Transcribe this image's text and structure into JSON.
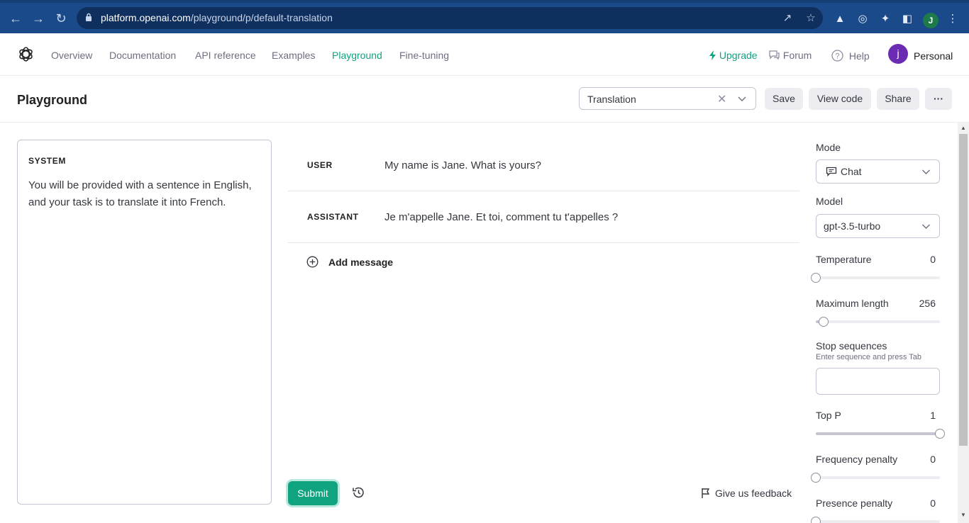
{
  "browser": {
    "url_host": "platform.openai.com",
    "url_path": "/playground/p/default-translation",
    "profile_initial": "J"
  },
  "nav": {
    "links": [
      "Overview",
      "Documentation",
      "API reference",
      "Examples",
      "Playground",
      "Fine-tuning"
    ],
    "active": "Playground",
    "upgrade": "Upgrade",
    "forum": "Forum",
    "help": "Help",
    "avatar_initial": "j",
    "account": "Personal"
  },
  "header": {
    "title": "Playground",
    "preset_value": "Translation",
    "save": "Save",
    "view_code": "View code",
    "share": "Share",
    "more": "···"
  },
  "system": {
    "label": "SYSTEM",
    "text": "You will be provided with a sentence in English, and your task is to translate it into French."
  },
  "messages": [
    {
      "role": "USER",
      "text": "My name is Jane. What is yours?"
    },
    {
      "role": "ASSISTANT",
      "text": "Je m'appelle Jane. Et toi, comment tu t'appelles ?"
    }
  ],
  "add_message": "Add message",
  "footer": {
    "submit": "Submit",
    "feedback": "Give us feedback"
  },
  "settings": {
    "mode_label": "Mode",
    "mode_value": "Chat",
    "model_label": "Model",
    "model_value": "gpt-3.5-turbo",
    "temperature_label": "Temperature",
    "temperature_value": "0",
    "temperature_fraction": 0,
    "max_length_label": "Maximum length",
    "max_length_value": "256",
    "max_length_fraction": 0.06,
    "stop_label": "Stop sequences",
    "stop_hint": "Enter sequence and press Tab",
    "top_p_label": "Top P",
    "top_p_value": "1",
    "top_p_fraction": 1,
    "freq_label": "Frequency penalty",
    "freq_value": "0",
    "freq_fraction": 0,
    "presence_label": "Presence penalty",
    "presence_value": "0",
    "presence_fraction": 0
  },
  "colors": {
    "brand_green": "#10a37f",
    "browser_blue": "#1a4a8a",
    "avatar_purple": "#6c2bb3"
  }
}
